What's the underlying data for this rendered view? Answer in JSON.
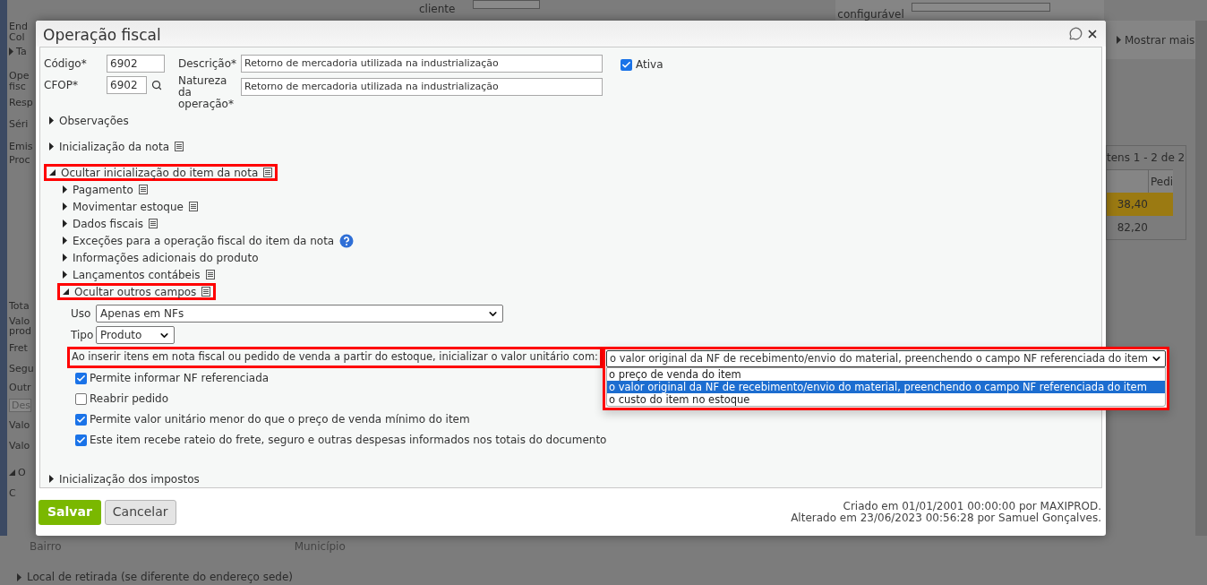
{
  "background": {
    "top_labels": [
      "cliente",
      "configurável"
    ],
    "left_labels": [
      {
        "text": "End",
        "kind": "text"
      },
      {
        "text": "Col",
        "kind": "text"
      },
      {
        "text": "Ta",
        "kind": "collapsed"
      },
      {
        "text": "Ope",
        "kind": "text"
      },
      {
        "text": "fisc",
        "kind": "text"
      },
      {
        "text": "Resp",
        "kind": "text"
      },
      {
        "text": "Séri",
        "kind": "text"
      },
      {
        "text": "Emis",
        "kind": "text"
      },
      {
        "text": "Proc",
        "kind": "text"
      },
      {
        "text": "Tota",
        "kind": "text"
      },
      {
        "text": "Valo",
        "kind": "text"
      },
      {
        "text": "prod",
        "kind": "text"
      },
      {
        "text": "Fret",
        "kind": "text"
      },
      {
        "text": "Segu",
        "kind": "text"
      },
      {
        "text": "Outr",
        "kind": "text"
      },
      {
        "text": "Des",
        "kind": "field"
      },
      {
        "text": "Valo",
        "kind": "text"
      },
      {
        "text": "Valo",
        "kind": "text"
      },
      {
        "text": "O",
        "kind": "expanded"
      },
      {
        "text": "C",
        "kind": "text"
      }
    ],
    "show_more": "Mostrar mais",
    "grid": {
      "pager": "tens 1 - 2 de 2",
      "column": "Pedi",
      "rows": [
        {
          "value": "38,40",
          "selected": true
        },
        {
          "value": "82,20",
          "selected": false
        }
      ]
    },
    "address": [
      "Bairro",
      "Município"
    ],
    "pickup_section": "Local de retirada (se diferente do endereço sede)"
  },
  "dialog": {
    "title": "Operação fiscal",
    "code": {
      "label": "Código*",
      "value": "6902"
    },
    "cfop": {
      "label": "CFOP*",
      "value": "6902"
    },
    "description": {
      "label": "Descrição*",
      "value": "Retorno de mercadoria utilizada na industrialização"
    },
    "nature": {
      "label": "Natureza da operação*",
      "value": "Retorno de mercadoria utilizada na industrialização"
    },
    "active": {
      "label": "Ativa",
      "checked": true
    },
    "sections": [
      {
        "label": "Observações",
        "expanded": false,
        "kind": "plain",
        "highlighted": false
      },
      {
        "label": "Inicialização da nota",
        "expanded": false,
        "kind": "notes",
        "highlighted": false
      },
      {
        "label": "Ocultar inicialização do item da nota",
        "expanded": true,
        "kind": "notes",
        "highlighted": true,
        "children": [
          {
            "label": "Pagamento",
            "expanded": false,
            "kind": "notes",
            "highlighted": false
          },
          {
            "label": "Movimentar estoque",
            "expanded": false,
            "kind": "notes",
            "highlighted": false
          },
          {
            "label": "Dados fiscais",
            "expanded": false,
            "kind": "notes",
            "highlighted": false
          },
          {
            "label": "Exceções para a operação fiscal do item da nota",
            "expanded": false,
            "kind": "help",
            "highlighted": false
          },
          {
            "label": "Informações adicionais do produto",
            "expanded": false,
            "kind": "plain",
            "highlighted": false
          },
          {
            "label": "Lançamentos contábeis",
            "expanded": false,
            "kind": "notes",
            "highlighted": false
          },
          {
            "label": "Ocultar outros campos",
            "expanded": true,
            "kind": "notes",
            "highlighted": true
          }
        ]
      }
    ],
    "other_fields": {
      "usage": {
        "label": "Uso",
        "value": "Apenas em NFs"
      },
      "type": {
        "label": "Tipo",
        "value": "Produto"
      },
      "unit_value": {
        "label": "Ao inserir itens em nota fiscal ou pedido de venda a partir do estoque, inicializar o valor unitário com:",
        "highlighted": true,
        "value": "o valor original da NF de recebimento/envio do material, preenchendo o campo NF referenciada do item",
        "options": [
          {
            "label": "o preço de venda do item",
            "selected": false
          },
          {
            "label": "o valor original da NF de recebimento/envio do material, preenchendo o campo NF referenciada do item",
            "selected": true
          },
          {
            "label": "o custo do item no estoque",
            "selected": false
          }
        ]
      },
      "checkboxes": [
        {
          "label": "Permite informar NF referenciada",
          "checked": true
        },
        {
          "label": "Reabrir pedido",
          "checked": false
        },
        {
          "label": "Permite valor unitário menor do que o preço de venda mínimo do item",
          "checked": true
        },
        {
          "label": "Este item recebe rateio do frete, seguro e outras despesas informados nos totais do documento",
          "checked": true
        }
      ]
    },
    "sections_after": [
      {
        "label": "Inicialização dos impostos",
        "expanded": false,
        "highlighted": false
      }
    ],
    "buttons": [
      {
        "label": "Salvar",
        "kind": "primary"
      },
      {
        "label": "Cancelar",
        "kind": "secondary"
      }
    ],
    "audit": [
      "Criado em 01/01/2001 00:00:00 por MAXIPROD.",
      "Alterado em 23/06/2023 00:56:28 por Samuel Gonçalves."
    ]
  }
}
